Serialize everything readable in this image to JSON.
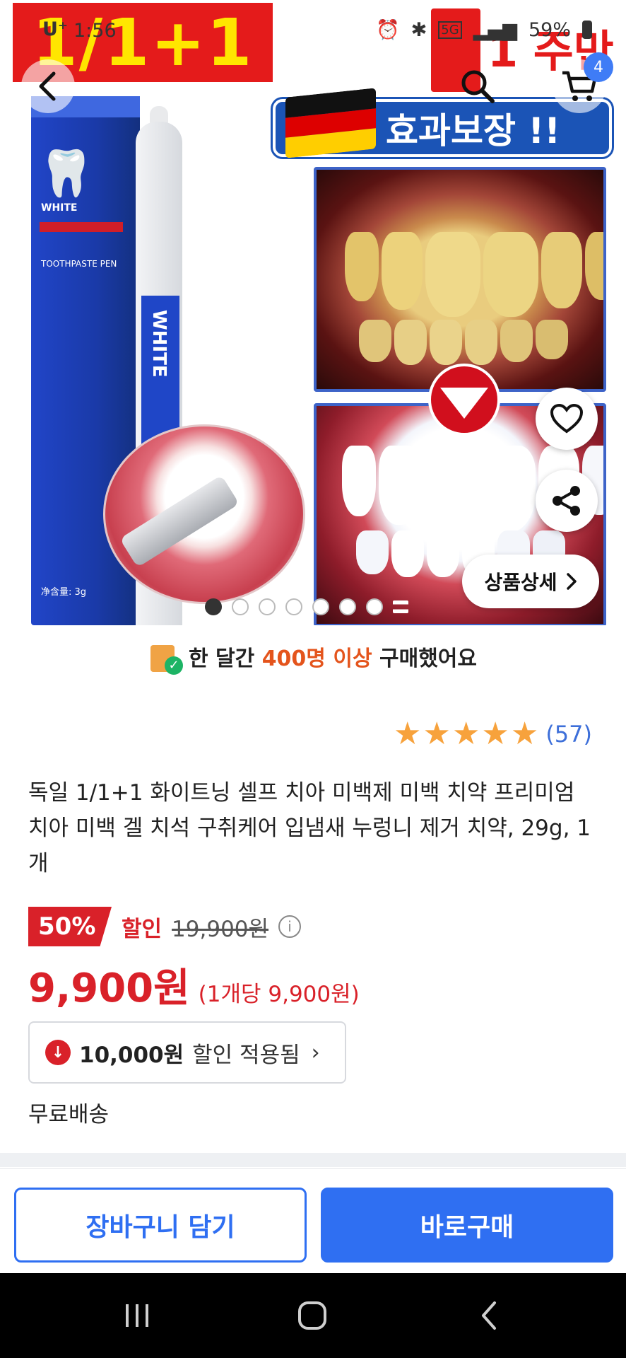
{
  "status_bar": {
    "carrier": "U⁺",
    "time": "1:56",
    "network": "5G",
    "battery": "59%"
  },
  "hero": {
    "promo_text": "1/1+1",
    "week_badge_text": "1 주만",
    "guarantee_text": "효과보장 !!",
    "box_label": "WHITE",
    "box_subtitle": "TOOTHPASTE PEN",
    "box_net": "净含量: 3g",
    "pen_label": "WHITE",
    "cart_count": "4",
    "detail_button": "상품상세",
    "image_dots_total": 7,
    "image_dots_active": 1
  },
  "purchase_info": {
    "prefix": "한 달간 ",
    "highlight": "400명 이상",
    "suffix": " 구매했어요"
  },
  "rating": {
    "stars": 5,
    "count": "(57)"
  },
  "product": {
    "title": "독일 1/1+1 화이트닝 셀프 치아 미백제 미백 치약 프리미엄 치아 미백 겔 치석 구취케어 입냄새 누렁니 제거 치약, 29g, 1개"
  },
  "pricing": {
    "discount_percent": "50%",
    "discount_label": "할인",
    "original_price": "19,900원",
    "price": "9,900원",
    "unit_price": "(1개당 9,900원)"
  },
  "coupon": {
    "amount": "10,000원",
    "status": "할인 적용됨"
  },
  "shipping": "무료배송",
  "actions": {
    "add_to_cart": "장바구니 담기",
    "buy_now": "바로구매"
  },
  "colors": {
    "accent_blue": "#2f6ff2",
    "sale_red": "#d92129",
    "star_orange": "#f7a23c",
    "highlight_orange": "#e4541c"
  }
}
